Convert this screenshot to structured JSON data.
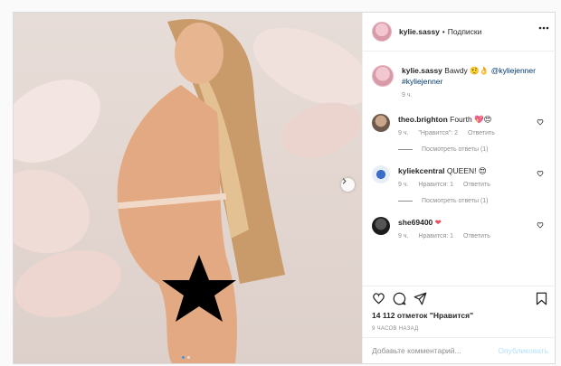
{
  "post": {
    "author": "kylie.sassy",
    "separator": "•",
    "follow_status": "Подписки",
    "media": {
      "slides_total": 2,
      "slide_index": 1
    }
  },
  "caption": {
    "username": "kylie.sassy",
    "text": "Bawdy 🤨👌",
    "mention1": "@kyliejenner",
    "mention2": "#kyliejenner",
    "time": "9 ч."
  },
  "comments": [
    {
      "username": "theo.brighton",
      "text": "Fourth 💖😍",
      "time": "9 ч.",
      "likes": "\"Нравится\": 2",
      "reply": "Ответить",
      "view_replies": "Посмотреть ответы (1)"
    },
    {
      "username": "kyliekcentral",
      "text": "QUEEN! 😍",
      "time": "9 ч.",
      "likes": "Нравится: 1",
      "reply": "Ответить",
      "view_replies": "Посмотреть ответы (1)"
    },
    {
      "username": "she69400",
      "text": "❤",
      "time": "9 ч.",
      "likes": "Нравится: 1",
      "reply": "Ответить"
    }
  ],
  "stats": {
    "likes": "14 112 отметок \"Нравится\"",
    "time_ago": "9 ЧАСОВ НАЗАД"
  },
  "composer": {
    "placeholder": "Добавьте комментарий...",
    "publish": "Опубликовать"
  },
  "icons": [
    "more-icon",
    "heart-icon",
    "comment-icon",
    "share-icon",
    "bookmark-icon",
    "chevron-right-icon"
  ],
  "colors": {
    "link": "#00376b",
    "meta": "#8e8e8e",
    "publish_disabled": "#b2dffc",
    "heart_red": "#ed4956"
  }
}
